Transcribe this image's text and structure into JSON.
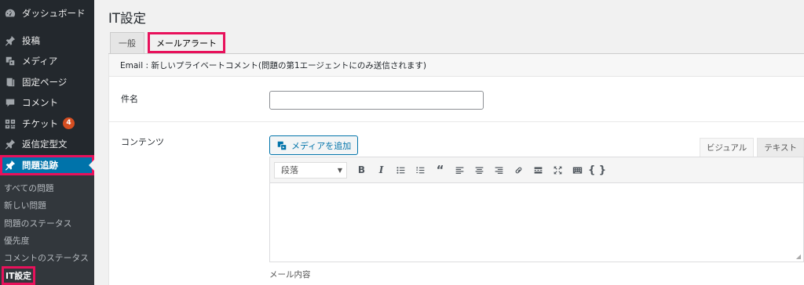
{
  "sidebar": {
    "items": [
      {
        "label": "ダッシュボード",
        "icon": "dashboard-icon"
      },
      {
        "label": "投稿",
        "icon": "pin-icon"
      },
      {
        "label": "メディア",
        "icon": "media-icon"
      },
      {
        "label": "固定ページ",
        "icon": "pages-icon"
      },
      {
        "label": "コメント",
        "icon": "comment-icon"
      },
      {
        "label": "チケット",
        "icon": "ticket-icon",
        "badge": "4"
      },
      {
        "label": "返信定型文",
        "icon": "pin-icon"
      },
      {
        "label": "問題追跡",
        "icon": "pin-icon"
      }
    ],
    "submenu": [
      "すべての問題",
      "新しい問題",
      "問題のステータス",
      "優先度",
      "コメントのステータス",
      "IT設定"
    ]
  },
  "page": {
    "title": "IT設定",
    "tabs": [
      "一般",
      "メールアラート"
    ]
  },
  "form": {
    "notice": "Email : 新しいプライベートコメント(問題の第1エージェントにのみ送信されます)",
    "subject_label": "件名",
    "subject_value": "",
    "content_label": "コンテンツ",
    "media_button": "メディアを追加",
    "mode_visual": "ビジュアル",
    "mode_text": "テキスト",
    "format_select": "段落",
    "footer_hint": "メール内容"
  },
  "colors": {
    "sidebar_bg": "#23282d",
    "active_bg": "#0073aa",
    "highlight": "#e8115b",
    "badge": "#d54e21"
  }
}
